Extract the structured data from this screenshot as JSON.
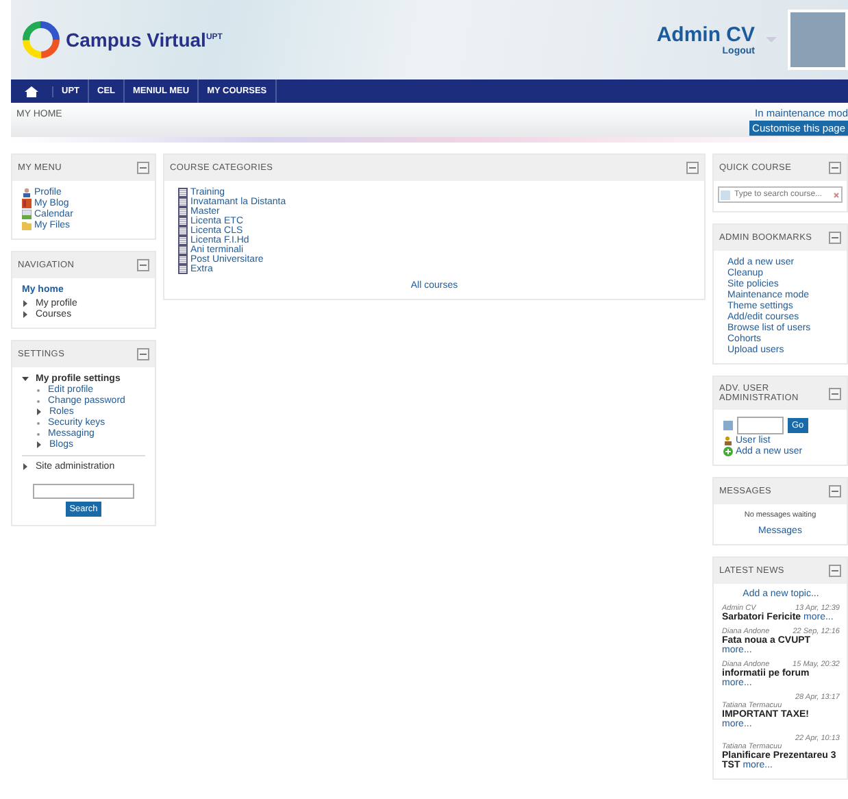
{
  "header": {
    "site_name": "Campus Virtual$^{UPT}$",
    "user_name": "Admin CV",
    "logout": "Logout"
  },
  "nav": [
    "UPT",
    "CEL",
    "MENIUL MEU",
    "MY COURSES"
  ],
  "breadcrumb": "MY HOME",
  "maintenance": "In maintenance mod",
  "customise_button": "Customise this page",
  "my_menu": {
    "title": "MY MENU",
    "items": [
      {
        "label": "Profile",
        "kind": "person"
      },
      {
        "label": "My Blog",
        "kind": "blog"
      },
      {
        "label": "Calendar",
        "kind": "calendar"
      },
      {
        "label": "My Files",
        "kind": "folder"
      }
    ]
  },
  "navigation": {
    "title": "NAVIGATION",
    "home": "My home",
    "items": [
      "My profile",
      "Courses"
    ]
  },
  "settings": {
    "title": "SETTINGS",
    "section": "My profile settings",
    "expanded": true,
    "items": [
      {
        "label": "Edit profile",
        "kind": "leaf"
      },
      {
        "label": "Change password",
        "kind": "leaf"
      },
      {
        "label": "Roles",
        "kind": "branch"
      },
      {
        "label": "Security keys",
        "kind": "leaf"
      },
      {
        "label": "Messaging",
        "kind": "leaf"
      },
      {
        "label": "Blogs",
        "kind": "branch"
      }
    ],
    "site_admin": "Site administration",
    "search_button": "Search"
  },
  "course_categories": {
    "title": "COURSE CATEGORIES",
    "items": [
      "Training",
      "Invatamant la Distanta",
      "Master",
      "Licenta ETC",
      "Licenta CLS",
      "Licenta F.I.Hd",
      "Ani terminali",
      "Post Universitare",
      "Extra"
    ],
    "all_courses": "All courses"
  },
  "quick_course": {
    "title": "QUICK COURSE",
    "placeholder": "Type to search course..."
  },
  "admin_bookmarks": {
    "title": "ADMIN BOOKMARKS",
    "items": [
      "Add a new user",
      "Cleanup",
      "Site policies",
      "Maintenance mode",
      "Theme settings",
      "Add/edit courses",
      "Browse list of users",
      "Cohorts",
      "Upload users"
    ]
  },
  "adv_user_admin": {
    "title": "ADV. USER ADMINISTRATION",
    "go": "Go",
    "links": [
      {
        "label": "User list",
        "kind": "users"
      },
      {
        "label": "Add a new user",
        "kind": "add"
      }
    ]
  },
  "messages": {
    "title": "MESSAGES",
    "empty": "No messages waiting",
    "link": "Messages"
  },
  "latest_news": {
    "title": "LATEST NEWS",
    "add": "Add a new topic...",
    "items": [
      {
        "kind": "inline",
        "author": "Admin CV",
        "date": "13 Apr, 12:39",
        "title": "Sarbatori Fericite",
        "more": "more..."
      },
      {
        "kind": "inline",
        "author": "Diana Andone",
        "date": "22 Sep, 12:16",
        "title": "Fata noua a CVUPT",
        "more": "more..."
      },
      {
        "kind": "inline",
        "author": "Diana Andone",
        "date": "15 May, 20:32",
        "title": "informatii pe forum",
        "more": "more..."
      },
      {
        "kind": "stacked",
        "author": "Tatiana Termacuu",
        "date": "28 Apr, 13:17",
        "title": "IMPORTANT TAXE!",
        "more": "more..."
      },
      {
        "kind": "stacked",
        "author": "Tatiana Termacuu",
        "date": "22 Apr, 10:13",
        "title": "Planificare Prezentareu 3 TST",
        "more": "more..."
      }
    ]
  }
}
